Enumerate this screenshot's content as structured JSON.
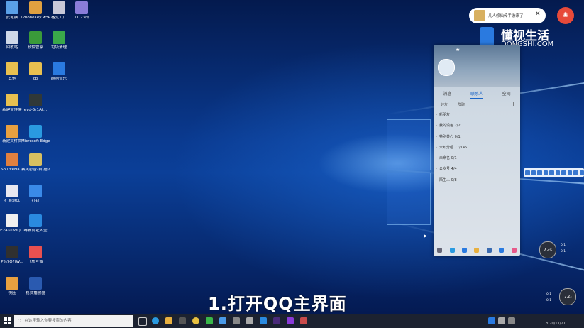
{
  "desktop_icons": [
    {
      "label": "此电脑",
      "color": "#5aa0e8"
    },
    {
      "label": "iPhoneKey\nw*PSDan*",
      "color": "#e0a040"
    },
    {
      "label": "格式工厂",
      "color": "#c8c8d8"
    },
    {
      "label": "11.23改",
      "color": "#8a7cd8"
    },
    {
      "label": "回收站",
      "color": "#cfd8e8"
    },
    {
      "label": "软件管家",
      "color": "#3a9a3a"
    },
    {
      "label": "垃圾清理",
      "color": "#3aa84a"
    },
    {
      "label": "其他",
      "color": "#e8c050"
    },
    {
      "label": "cp",
      "color": "#e8c050"
    },
    {
      "label": "酷狗音乐",
      "color": "#2a7ae0"
    },
    {
      "label": "新建文件夹",
      "color": "#e8c050"
    },
    {
      "label": "eyd-5r1At...",
      "color": "#303838"
    },
    {
      "label": "新建文件夹",
      "color": "#e8a040"
    },
    {
      "label": "Microsoft\nEdge",
      "color": "#2a9ae0"
    },
    {
      "label": "SourceHa...",
      "color": "#e08040"
    },
    {
      "label": "暴风影音-首\n播体-体验...",
      "color": "#d8c060"
    },
    {
      "label": "扩展测试",
      "color": "#e8e8f0"
    },
    {
      "label": "钉钉",
      "color": "#3a8ae8"
    },
    {
      "label": "E2A~0WQ...",
      "color": "#f0f0f0"
    },
    {
      "label": "毒霸网址大全",
      "color": "#2a8ae0"
    },
    {
      "label": "P%7Q?(W...",
      "color": "#303030"
    },
    {
      "label": "飞鱼互娱",
      "color": "#e85050"
    },
    {
      "label": "快压",
      "color": "#e8a040"
    },
    {
      "label": "格式播放器",
      "color": "#2a5ab0"
    }
  ],
  "notification": {
    "text": "凡人修仙传手游来了!"
  },
  "watermark": {
    "cn": "懂视生活",
    "en": "DONGSHI.COM"
  },
  "qq": {
    "tabs": [
      {
        "label": "消息"
      },
      {
        "label": "联系人"
      },
      {
        "label": "空间"
      }
    ],
    "subtabs": [
      {
        "label": "好友"
      },
      {
        "label": "群聊"
      }
    ],
    "add": "+",
    "groups": [
      {
        "label": "新朋友"
      },
      {
        "label": "我的设备 2/2"
      },
      {
        "label": "特别关心 0/1"
      },
      {
        "label": "未知分组 77/145"
      },
      {
        "label": "未命名 0/1"
      },
      {
        "label": "公众号 4/4"
      },
      {
        "label": "陌生人 0/8"
      }
    ],
    "bottom_icons": [
      "menu-icon",
      "contacts-icon",
      "music-icon",
      "folder-icon",
      "mail-icon",
      "shield-icon",
      "apps-icon"
    ]
  },
  "perf_widget_1": {
    "value": "72",
    "unit": "%",
    "up": "0.1",
    "down": "0.1"
  },
  "perf_widget_2": {
    "value": "72",
    "unit": "c",
    "up": "0.1",
    "down": "0.1"
  },
  "caption": "1.打开QQ主界面",
  "taskbar": {
    "search_placeholder": "在这里输入你要搜索的内容",
    "date": "2020/11/27"
  }
}
